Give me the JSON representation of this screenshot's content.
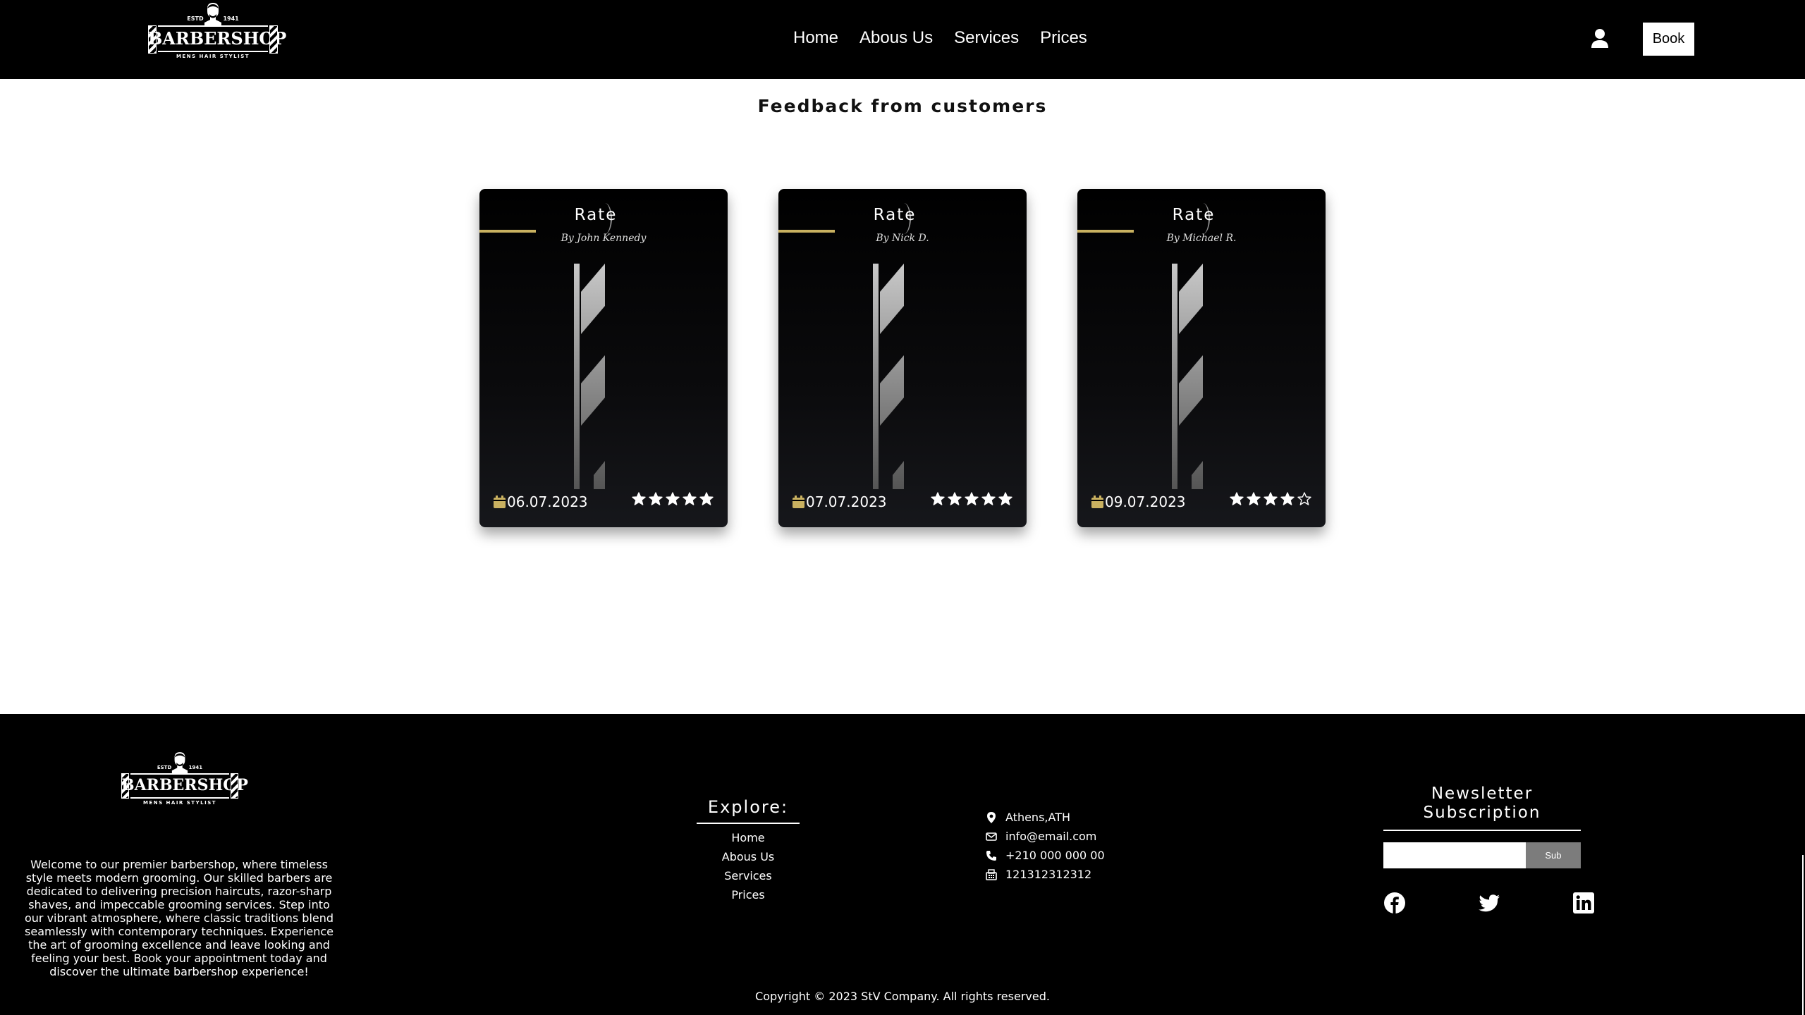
{
  "header": {
    "logo": {
      "estd": "ESTD",
      "year": "1941",
      "brand": "BARBERSHOP",
      "tagline": "MENS HAIR STYLIST"
    },
    "nav": [
      {
        "label": "Home"
      },
      {
        "label": "Abous Us"
      },
      {
        "label": "Services"
      },
      {
        "label": "Prices"
      }
    ],
    "user_icon": "user-icon",
    "book_label": "Book"
  },
  "feedback": {
    "title": "Feedback from customers",
    "cards": [
      {
        "title": "Rate",
        "author": "By John Kennedy",
        "date": "06.07.2023",
        "rating": 5,
        "max_rating": 5
      },
      {
        "title": "Rate",
        "author": "By Nick D.",
        "date": "07.07.2023",
        "rating": 5,
        "max_rating": 5
      },
      {
        "title": "Rate",
        "author": "By Michael R.",
        "date": "09.07.2023",
        "rating": 4,
        "max_rating": 5
      }
    ]
  },
  "footer": {
    "logo": {
      "estd": "ESTD",
      "year": "1941",
      "brand": "BARBERSHOP",
      "tagline": "MENS HAIR STYLIST"
    },
    "about": "Welcome to our premier barbershop, where timeless style meets modern grooming. Our skilled barbers are dedicated to delivering precision haircuts, razor-sharp shaves, and impeccable grooming services. Step into our vibrant atmosphere, where classic traditions blend seamlessly with contemporary techniques. Experience the art of grooming excellence and leave looking and feeling your best. Book your appointment today and discover the ultimate barbershop experience!",
    "explore": {
      "title": "Explore:",
      "links": [
        {
          "label": "Home"
        },
        {
          "label": "Abous Us"
        },
        {
          "label": "Services"
        },
        {
          "label": "Prices"
        }
      ]
    },
    "contact": [
      {
        "icon": "map-pin-icon",
        "text": "Athens,ATH"
      },
      {
        "icon": "envelope-icon",
        "text": "info@email.com"
      },
      {
        "icon": "phone-icon",
        "text": "+210 000 000 00"
      },
      {
        "icon": "fax-icon",
        "text": "121312312312"
      }
    ],
    "newsletter": {
      "title": "Newsletter Subscription",
      "input_value": "",
      "input_placeholder": "",
      "submit_label": "Sub"
    },
    "socials": [
      "facebook-icon",
      "twitter-icon",
      "linkedin-icon"
    ],
    "copyright": "Copyright © 2023 StV Company. All rights reserved."
  },
  "colors": {
    "header_bg": "#000000",
    "accent_gold": "#c9b160",
    "page_bg": "#ffffff",
    "card_bg": "#0b0b0d",
    "subscribe_button": "#7c7c7c"
  }
}
